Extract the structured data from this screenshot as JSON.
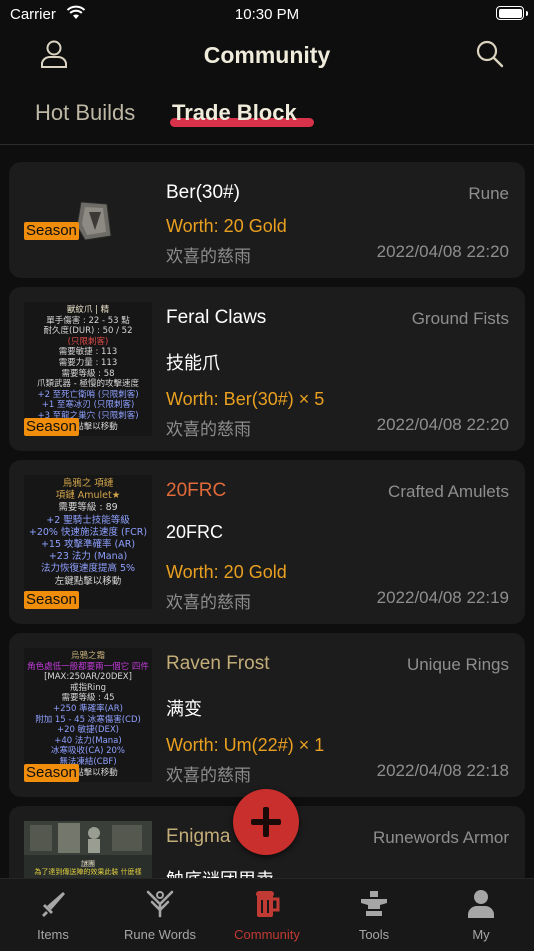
{
  "status_bar": {
    "carrier": "Carrier",
    "time": "10:30 PM"
  },
  "header": {
    "title": "Community"
  },
  "segments": {
    "hot": "Hot Builds",
    "trade": "Trade Block"
  },
  "listings": [
    {
      "name": "Ber(30#)",
      "category": "Rune",
      "description": "",
      "worth": "Worth: 20 Gold",
      "seller": "欢喜的慈雨",
      "date": "2022/04/08 22:20",
      "badge": "Season",
      "name_style": "normal"
    },
    {
      "name": "Feral Claws",
      "category": "Ground Fists",
      "description": "技能爪",
      "worth": "Worth: Ber(30#) × 5",
      "seller": "欢喜的慈雨",
      "date": "2022/04/08 22:20",
      "badge": "Season",
      "name_style": "normal",
      "tooltip": [
        "獸紋爪 | 精",
        "單手傷害 : 22 - 53 點",
        "耐久度(DUR) : 50 / 52",
        "(只限刺客)",
        "需要敏捷 : 113",
        "需要力量 : 113",
        "需要等級 : 58",
        "爪類武器 - 極慢的攻擊速度",
        "+2 至死亡衛哨 (只限刺客)",
        "+1 至寒冰刃 (只限刺客)",
        "+3 至龍之巢穴 (只限刺客)",
        "左鍵點擊以移動"
      ]
    },
    {
      "name": "20FRC",
      "category": "Crafted Amulets",
      "description": "20FRC",
      "worth": "Worth: 20 Gold",
      "seller": "欢喜的慈雨",
      "date": "2022/04/08 22:19",
      "badge": "Season",
      "name_style": "crafted",
      "tooltip": [
        "烏鴉之 項鏈",
        "項鏈 Amulet★",
        "需要等級 : 89",
        "+2 聖騎士技能等級",
        "+20% 快速施法速度 (FCR)",
        "+15 攻擊準確率 (AR)",
        "+23 法力 (Mana)",
        "法力恢復速度提高 5%",
        "左鍵點擊以移動"
      ]
    },
    {
      "name": "Raven Frost",
      "category": "Unique Rings",
      "description": "满变",
      "worth": "Worth: Um(22#) × 1",
      "seller": "欢喜的慈雨",
      "date": "2022/04/08 22:18",
      "badge": "Season",
      "name_style": "unique",
      "tooltip": [
        "烏鴉之霜",
        "角色處低一般都要兩一個它 四件",
        "[MAX:250AR/20DEX]",
        "戒指Ring",
        "需要等級 : 45",
        "+250 準確率(AR)",
        "附加 15 - 45 冰寒傷害(CD)",
        "+20 敏捷(DEX)",
        "+40 法力(Mana)",
        "冰寒吸收(CA) 20%",
        "無法凍結(CBF)",
        "左鍵點擊以移動"
      ]
    },
    {
      "name": "Enigma",
      "category": "Runewords Armor",
      "description": "触底谜团甩卖",
      "worth": "",
      "seller": "",
      "date": "",
      "badge": "",
      "name_style": "normal",
      "tooltip": [
        "謎團",
        "為了達到傳送陣的效果此裝 什麼樣"
      ]
    }
  ],
  "tabs": [
    {
      "label": "Items",
      "icon": "sword-icon"
    },
    {
      "label": "Rune Words",
      "icon": "rune-icon"
    },
    {
      "label": "Community",
      "icon": "beer-mug-icon",
      "active": true
    },
    {
      "label": "Tools",
      "icon": "anvil-icon"
    },
    {
      "label": "My",
      "icon": "person-icon"
    }
  ],
  "colors": {
    "accent": "#c13a34",
    "worth": "#e9a020",
    "season_badge": "#f08e0c",
    "crafted_name": "#e06a3a",
    "unique_name": "#c3ad79",
    "underline": "#d8324a"
  }
}
